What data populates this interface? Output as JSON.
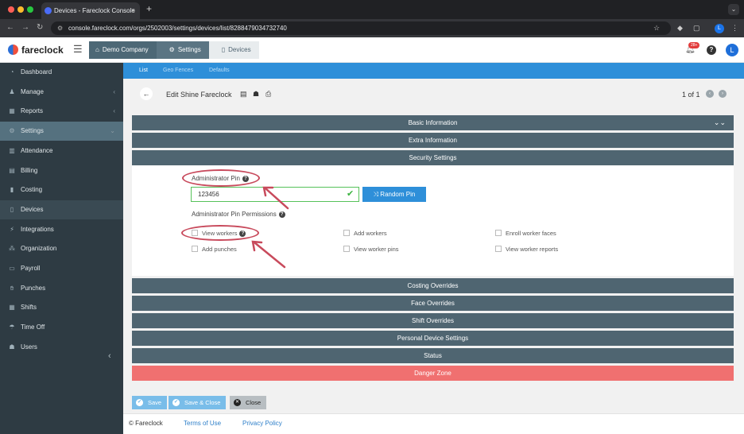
{
  "browser": {
    "tab_title": "Devices - Fareclock Console",
    "tab_close": "×",
    "new_tab": "+",
    "url": "console.fareclock.com/orgs/2502003/settings/devices/list/8288479034732740",
    "profile_initial": "L"
  },
  "header": {
    "logo_text": "fareclock",
    "breadcrumbs": [
      {
        "label": "Demo Company",
        "icon": "home-icon"
      },
      {
        "label": "Settings",
        "icon": "gear-icon"
      },
      {
        "label": "Devices",
        "icon": "tablet-icon"
      }
    ],
    "notification_count": "28+",
    "help": "?",
    "avatar_initial": "L"
  },
  "sidebar": {
    "items": [
      {
        "label": "Dashboard",
        "icon": "dashboard-icon",
        "chevron": ""
      },
      {
        "label": "Manage",
        "icon": "user-icon",
        "chevron": "‹"
      },
      {
        "label": "Reports",
        "icon": "chart-icon",
        "chevron": "‹"
      },
      {
        "label": "Settings",
        "icon": "gear-icon",
        "chevron": "⌄"
      },
      {
        "label": "Attendance",
        "icon": "attendance-icon",
        "chevron": ""
      },
      {
        "label": "Billing",
        "icon": "billing-icon",
        "chevron": ""
      },
      {
        "label": "Costing",
        "icon": "costing-icon",
        "chevron": ""
      },
      {
        "label": "Devices",
        "icon": "tablet-icon",
        "chevron": ""
      },
      {
        "label": "Integrations",
        "icon": "plug-icon",
        "chevron": ""
      },
      {
        "label": "Organization",
        "icon": "org-icon",
        "chevron": ""
      },
      {
        "label": "Payroll",
        "icon": "payroll-icon",
        "chevron": ""
      },
      {
        "label": "Punches",
        "icon": "punch-icon",
        "chevron": ""
      },
      {
        "label": "Shifts",
        "icon": "calendar-icon",
        "chevron": ""
      },
      {
        "label": "Time Off",
        "icon": "umbrella-icon",
        "chevron": ""
      },
      {
        "label": "Users",
        "icon": "users-icon",
        "chevron": ""
      }
    ],
    "collapse": "‹"
  },
  "subnav": {
    "tabs": [
      {
        "label": "List"
      },
      {
        "label": "Geo Fences"
      },
      {
        "label": "Defaults"
      }
    ]
  },
  "toolbar": {
    "back": "←",
    "title": "Edit Shine Fareclock",
    "pager_text": "1 of 1",
    "prev": "‹",
    "next": "›"
  },
  "sections": {
    "basic": "Basic Information",
    "extra": "Extra Information",
    "security": "Security Settings",
    "costing": "Costing Overrides",
    "face": "Face Overrides",
    "shift": "Shift Overrides",
    "personal": "Personal Device Settings",
    "status": "Status",
    "danger": "Danger Zone",
    "collapse_toggle": "⌄⌄"
  },
  "security": {
    "admin_pin_label": "Administrator Pin",
    "admin_pin_value": "123456",
    "random_pin_label": "Random Pin",
    "permissions_label": "Administrator Pin Permissions",
    "permissions": [
      {
        "label": "View workers"
      },
      {
        "label": "Add workers"
      },
      {
        "label": "Enroll worker faces"
      },
      {
        "label": "Add punches"
      },
      {
        "label": "View worker pins"
      },
      {
        "label": "View worker reports"
      }
    ]
  },
  "actions": {
    "save": "Save",
    "save_close": "Save & Close",
    "close": "Close"
  },
  "footer": {
    "copyright": "© Fareclock",
    "terms": "Terms of Use",
    "privacy": "Privacy Policy"
  },
  "colors": {
    "primary": "#2e8fd9",
    "section_bar": "#4f6571",
    "danger": "#f07070",
    "sidebar": "#2e3b43",
    "annotation": "#c84a5c"
  }
}
